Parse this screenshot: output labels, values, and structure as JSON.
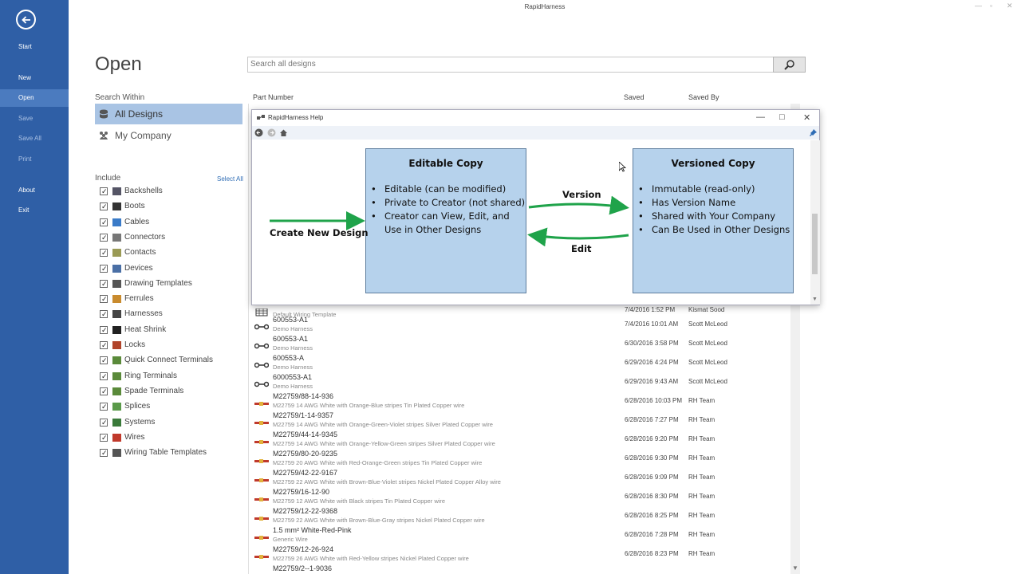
{
  "app": {
    "title": "RapidHarness",
    "page_title": "Open"
  },
  "nav": {
    "start": "Start",
    "items": [
      {
        "label": "New"
      },
      {
        "label": "Open"
      },
      {
        "label": "Save"
      },
      {
        "label": "Save All"
      },
      {
        "label": "Print"
      },
      {
        "label": "About"
      },
      {
        "label": "Exit"
      }
    ]
  },
  "search": {
    "placeholder": "Search all designs"
  },
  "search_within": {
    "label": "Search Within",
    "options": [
      {
        "label": "All Designs"
      },
      {
        "label": "My Company"
      }
    ]
  },
  "include": {
    "label": "Include",
    "select_all": "Select All",
    "items": [
      "Backshells",
      "Boots",
      "Cables",
      "Connectors",
      "Contacts",
      "Devices",
      "Drawing Templates",
      "Ferrules",
      "Harnesses",
      "Heat Shrink",
      "Locks",
      "Quick Connect Terminals",
      "Ring Terminals",
      "Spade Terminals",
      "Splices",
      "Systems",
      "Wires",
      "Wiring Table Templates"
    ]
  },
  "table": {
    "headers": {
      "part_number": "Part Number",
      "saved": "Saved",
      "saved_by": "Saved By"
    },
    "rows": [
      {
        "pn": "",
        "desc": "Default Wiring Template",
        "saved": "7/4/2016 1:52 PM",
        "by": "Kismat Sood",
        "icon": "template"
      },
      {
        "pn": "600553-A1",
        "desc": "Demo Harness",
        "saved": "7/4/2016 10:01 AM",
        "by": "Scott McLeod",
        "icon": "harness"
      },
      {
        "pn": "600553-A1",
        "desc": "Demo Harness",
        "saved": "6/30/2016 3:58 PM",
        "by": "Scott McLeod",
        "icon": "harness"
      },
      {
        "pn": "600553-A",
        "desc": "Demo Harness",
        "saved": "6/29/2016 4:24 PM",
        "by": "Scott McLeod",
        "icon": "harness"
      },
      {
        "pn": "6000553-A1",
        "desc": "Demo Harness",
        "saved": "6/29/2016 9:43 AM",
        "by": "Scott McLeod",
        "icon": "harness"
      },
      {
        "pn": "M22759/88-14-936",
        "desc": "M22759 14 AWG White with Orange-Blue stripes Tin Plated Copper wire",
        "saved": "6/28/2016 10:03 PM",
        "by": "RH Team",
        "icon": "wire"
      },
      {
        "pn": "M22759/1-14-9357",
        "desc": "M22759 14 AWG White with Orange-Green-Violet stripes Silver Plated Copper wire",
        "saved": "6/28/2016 7:27 PM",
        "by": "RH Team",
        "icon": "wire"
      },
      {
        "pn": "M22759/44-14-9345",
        "desc": "M22759 14 AWG White with Orange-Yellow-Green stripes Silver Plated Copper wire",
        "saved": "6/28/2016 9:20 PM",
        "by": "RH Team",
        "icon": "wire"
      },
      {
        "pn": "M22759/80-20-9235",
        "desc": "M22759 20 AWG White with Red-Orange-Green stripes Tin Plated Copper wire",
        "saved": "6/28/2016 9:30 PM",
        "by": "RH Team",
        "icon": "wire"
      },
      {
        "pn": "M22759/42-22-9167",
        "desc": "M22759 22 AWG White with Brown-Blue-Violet stripes Nickel Plated Copper Alloy wire",
        "saved": "6/28/2016 9:09 PM",
        "by": "RH Team",
        "icon": "wire"
      },
      {
        "pn": "M22759/16-12-90",
        "desc": "M22759 12 AWG White with Black stripes Tin Plated Copper wire",
        "saved": "6/28/2016 8:30 PM",
        "by": "RH Team",
        "icon": "wire"
      },
      {
        "pn": "M22759/12-22-9368",
        "desc": "M22759 22 AWG White with Brown-Blue-Gray stripes Nickel Plated Copper wire",
        "saved": "6/28/2016 8:25 PM",
        "by": "RH Team",
        "icon": "wire"
      },
      {
        "pn": "1.5 mm² White-Red-Pink",
        "desc": "Generic Wire",
        "saved": "6/28/2016 7:28 PM",
        "by": "RH Team",
        "icon": "wire"
      },
      {
        "pn": "M22759/12-26-924",
        "desc": "M22759 26 AWG White with Red-Yellow stripes Nickel Plated Copper wire",
        "saved": "6/28/2016 8:23 PM",
        "by": "RH Team",
        "icon": "wire"
      },
      {
        "pn": "M22759/2--1-9036",
        "desc": "",
        "saved": "",
        "by": "",
        "icon": "wire"
      }
    ]
  },
  "help": {
    "title": "RapidHarness Help",
    "create_label": "Create New Design",
    "version_label": "Version",
    "edit_label": "Edit",
    "editable": {
      "title": "Editable Copy",
      "bullets": [
        "Editable (can be modified)",
        "Private to Creator (not shared)",
        "Creator can View, Edit, and Use in Other Designs"
      ]
    },
    "versioned": {
      "title": "Versioned Copy",
      "bullets": [
        "Immutable (read-only)",
        "Has Version Name",
        "Shared with Your Company",
        "Can Be Used in Other Designs"
      ]
    }
  },
  "colors": {
    "nav": "#2f5fa6",
    "nav_active": "#4b7bbf",
    "selection": "#a9c4e4",
    "box": "#b6d2ec",
    "arrow": "#1fa34a"
  }
}
